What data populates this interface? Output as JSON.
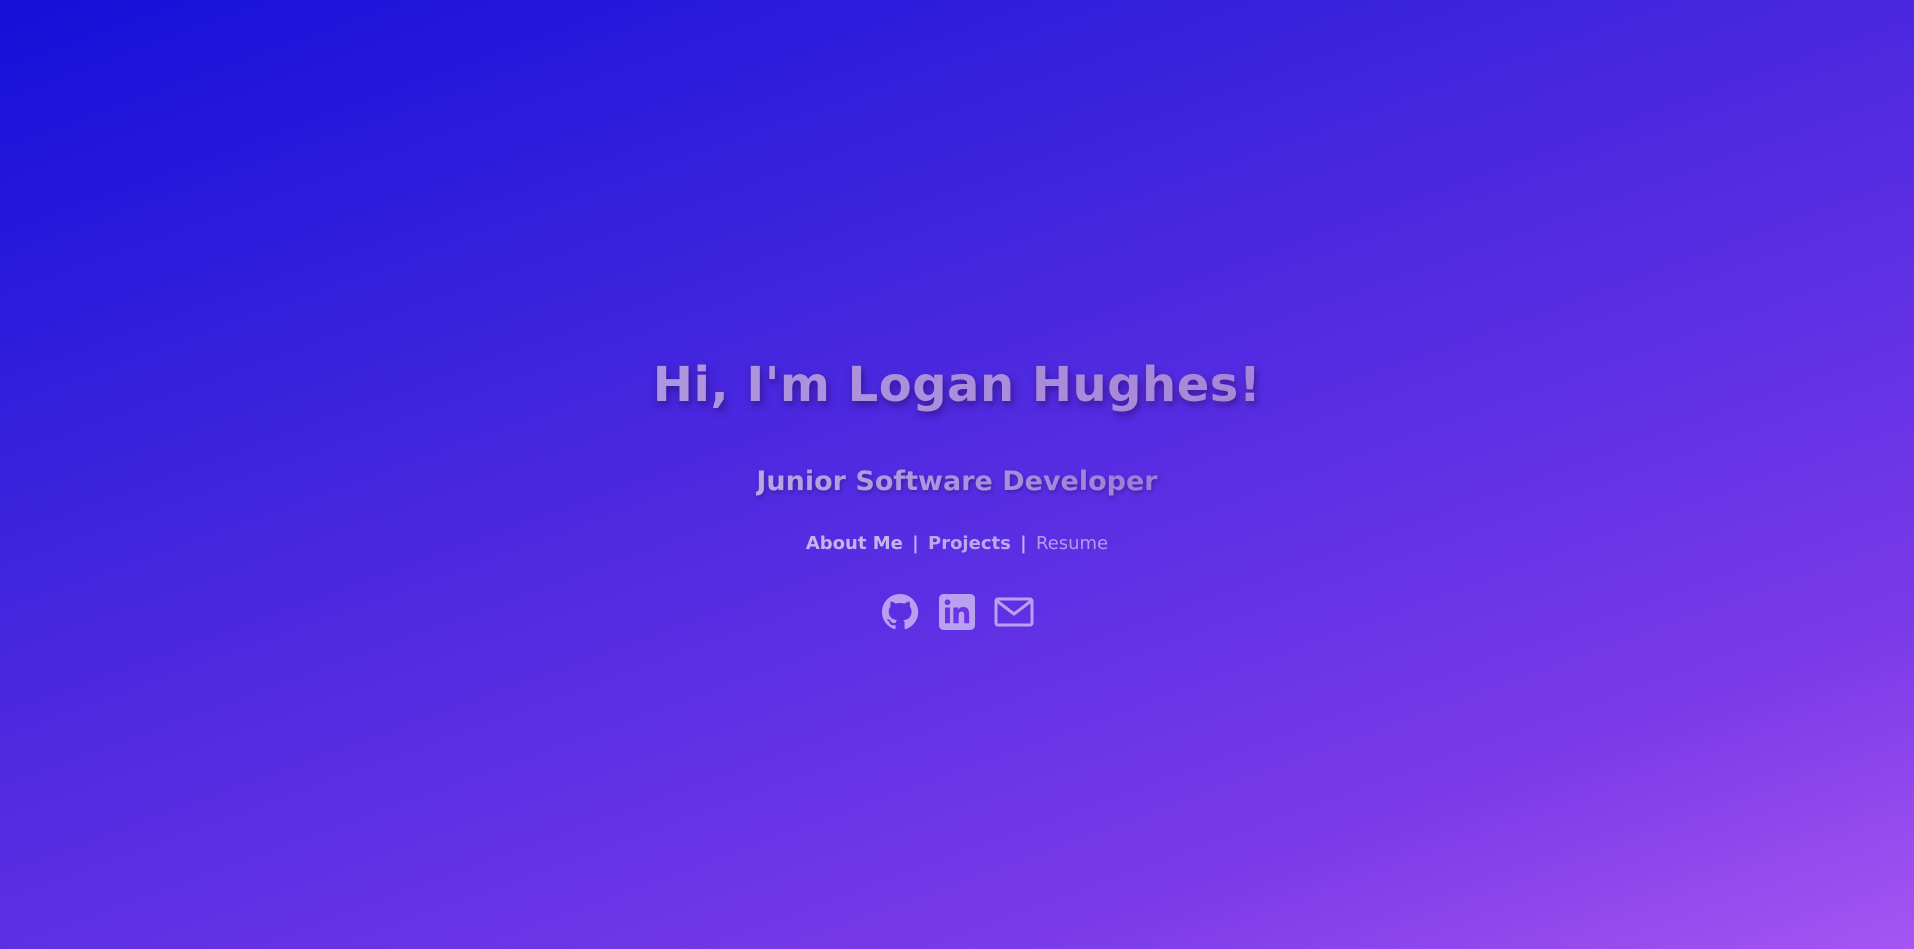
{
  "hero": {
    "title": "Hi, I'm Logan Hughes!",
    "subtitle": "Junior Software Developer"
  },
  "nav": {
    "about_label": "About Me",
    "separator": "|",
    "projects_label": "Projects",
    "resume_label": "Resume"
  },
  "socials": [
    {
      "icon": "github-icon"
    },
    {
      "icon": "linkedin-icon"
    },
    {
      "icon": "mail-icon"
    }
  ],
  "colors": {
    "background_start": "#1410d9",
    "background_end": "#a655f2",
    "icon_color": "#b9a0f0"
  }
}
